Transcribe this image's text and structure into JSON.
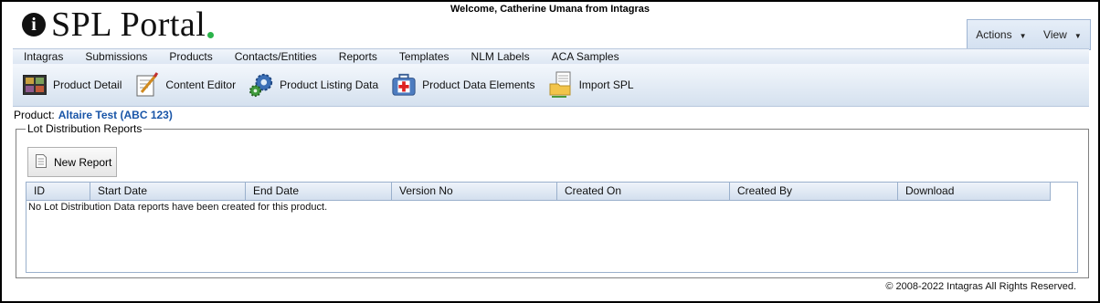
{
  "header": {
    "logo_text": "SPL Portal",
    "logo_badge": "i",
    "welcome": "Welcome, Catherine Umana from Intagras",
    "actions_label": "Actions",
    "view_label": "View"
  },
  "menu": [
    "Intagras",
    "Submissions",
    "Products",
    "Contacts/Entities",
    "Reports",
    "Templates",
    "NLM Labels",
    "ACA Samples"
  ],
  "toolbar": [
    "Product Detail",
    "Content Editor",
    "Product Listing Data",
    "Product Data Elements",
    "Import SPL"
  ],
  "product": {
    "label": "Product:",
    "value": "Altaire Test (ABC 123)"
  },
  "panel": {
    "legend": "Lot Distribution Reports",
    "new_report": "New Report",
    "columns": [
      "ID",
      "Start Date",
      "End Date",
      "Version No",
      "Created On",
      "Created By",
      "Download"
    ],
    "empty_message": "No Lot Distribution Data reports have been created for this product."
  },
  "footer": "© 2008-2022 Intagras All Rights Reserved."
}
